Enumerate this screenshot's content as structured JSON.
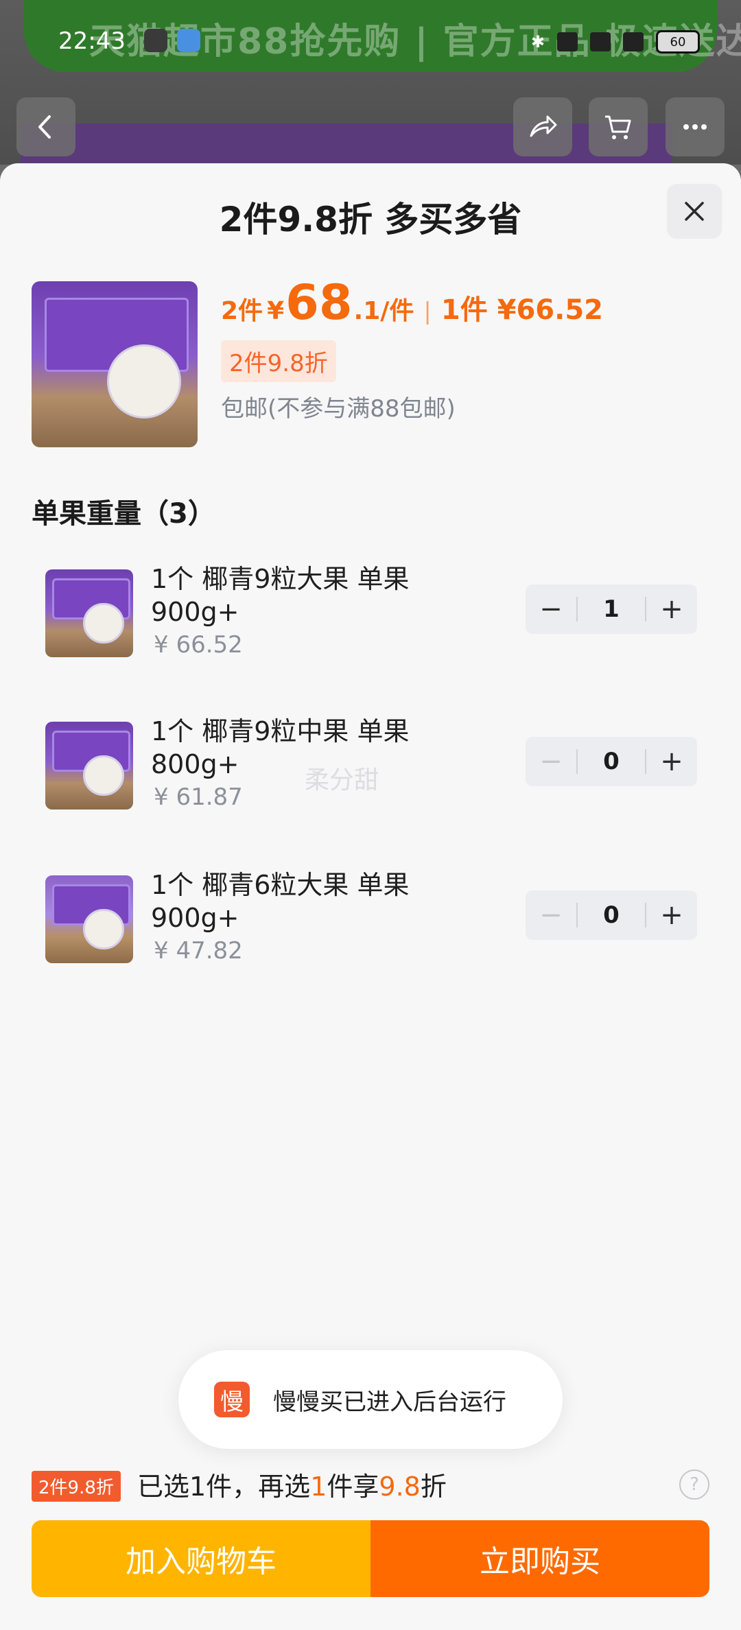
{
  "status_bar": {
    "time": "22:43",
    "battery": "60"
  },
  "background": {
    "promo_text": "天猫超市88抢先购 | 官方正品 极速送达"
  },
  "sheet": {
    "title": "2件9.8折 多买多省",
    "product": {
      "price_prefix": "2件",
      "currency": "¥",
      "price_int": "68",
      "price_dec": ".1/件",
      "separator": "|",
      "single_price": "1件 ¥66.52",
      "discount_badge": "2件9.8折",
      "shipping": "包邮(不参与满88包邮)"
    },
    "section_title": "单果重量（3）",
    "skus": [
      {
        "name": "1个 椰青9粒大果 单果900g+",
        "price": "¥ 66.52",
        "qty": "1"
      },
      {
        "name": "1个 椰青9粒中果 单果800g+",
        "price": "¥ 61.87",
        "qty": "0"
      },
      {
        "name": "1个 椰青6粒大果 单果900g+",
        "price": "¥ 47.82",
        "qty": "0"
      }
    ],
    "watermark": "柔分甜",
    "toast": {
      "icon": "慢",
      "text": "慢慢买已进入后台运行"
    },
    "tip": {
      "badge": "2件9.8折",
      "pre": "已选1件，再选",
      "n": "1",
      "mid": "件享",
      "rate": "9.8",
      "post": "折"
    },
    "buttons": {
      "cart": "加入购物车",
      "buy": "立即购买"
    }
  },
  "colors": {
    "accent": "#f56a0c",
    "cart": "#ffb400",
    "buy": "#ff6a00"
  }
}
